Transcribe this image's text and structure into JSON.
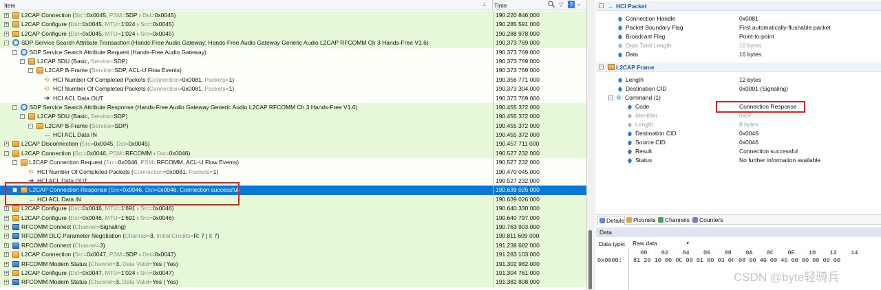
{
  "header": {
    "item_col": "Item",
    "time_col": "Time",
    "filter_badge": "3"
  },
  "rows": [
    {
      "indent": 0,
      "exp": "+",
      "icon": "fold",
      "parts": [
        [
          "L2CAP Connection (",
          ""
        ],
        [
          "Src=",
          "d"
        ],
        [
          "0x0045, ",
          ""
        ],
        [
          "PSM=",
          "d"
        ],
        [
          "SDP › ",
          ""
        ],
        [
          "Dst=",
          "d"
        ],
        [
          "0x0045)",
          ""
        ]
      ],
      "time": "190.220 846 000",
      "bg": "green"
    },
    {
      "indent": 0,
      "exp": "+",
      "icon": "fold",
      "parts": [
        [
          "L2CAP Configure (",
          ""
        ],
        [
          "Dst=",
          "d"
        ],
        [
          "0x0045, ",
          ""
        ],
        [
          "MTU=",
          "d"
        ],
        [
          "1'024 › ",
          ""
        ],
        [
          "Src=",
          "d"
        ],
        [
          "0x0045)",
          ""
        ]
      ],
      "time": "190.285 591 000",
      "bg": "green"
    },
    {
      "indent": 0,
      "exp": "+",
      "icon": "fold",
      "parts": [
        [
          "L2CAP Configure (",
          ""
        ],
        [
          "Dst=",
          "d"
        ],
        [
          "0x0045, ",
          ""
        ],
        [
          "MTU=",
          "d"
        ],
        [
          "1'024 › ",
          ""
        ],
        [
          "Src=",
          "d"
        ],
        [
          "0x0045)",
          ""
        ]
      ],
      "time": "190.288 978 000",
      "bg": "green"
    },
    {
      "indent": 0,
      "exp": "-",
      "icon": "sdp",
      "parts": [
        [
          "SDP Service Search Attribute Transaction (Hands-Free Audio Gateway: Hands-Free Audio Gateway Generic Audio L2CAP RFCOMM Ch 3 Hands-Free V1.6)",
          ""
        ]
      ],
      "time": "190.373 769 000",
      "bg": "green"
    },
    {
      "indent": 1,
      "exp": "-",
      "icon": "sdp",
      "parts": [
        [
          "SDP Service Search Attribute Request (Hands-Free Audio Gateway)",
          ""
        ]
      ],
      "time": "190.373 769 000",
      "bg": "white"
    },
    {
      "indent": 2,
      "exp": "-",
      "icon": "fold",
      "parts": [
        [
          "L2CAP SDU (Basic, ",
          ""
        ],
        [
          "Service=",
          "d"
        ],
        [
          "SDP)",
          ""
        ]
      ],
      "time": "190.373 769 000",
      "bg": "white"
    },
    {
      "indent": 3,
      "exp": "-",
      "icon": "fold",
      "parts": [
        [
          "L2CAP B-Frame (",
          ""
        ],
        [
          "Service=",
          "d"
        ],
        [
          "SDP, ACL-U Flow Events)",
          ""
        ]
      ],
      "time": "190.373 769 000",
      "bg": "white"
    },
    {
      "indent": 4,
      "exp": "",
      "icon": "hci",
      "parts": [
        [
          "HCI Number Of Completed Packets (",
          ""
        ],
        [
          "Connection=",
          "d"
        ],
        [
          "0x0081, ",
          ""
        ],
        [
          "Packets=",
          "d"
        ],
        [
          "1)",
          ""
        ]
      ],
      "time": "190.356 771 000",
      "bg": "white"
    },
    {
      "indent": 4,
      "exp": "",
      "icon": "hci",
      "parts": [
        [
          "HCI Number Of Completed Packets (",
          ""
        ],
        [
          "Connection=",
          "d"
        ],
        [
          "0x0081, ",
          ""
        ],
        [
          "Packets=",
          "d"
        ],
        [
          "1)",
          ""
        ]
      ],
      "time": "190.373 304 000",
      "bg": "white"
    },
    {
      "indent": 4,
      "exp": "",
      "icon": "out",
      "parts": [
        [
          "HCI ACL Data OUT",
          ""
        ]
      ],
      "time": "190.373 769 000",
      "bg": "white"
    },
    {
      "indent": 1,
      "exp": "-",
      "icon": "sdp",
      "parts": [
        [
          "SDP Service Search Attribute Response (Hands-Free Audio Gateway Generic Audio L2CAP RFCOMM Ch 3 Hands-Free V1.6)",
          ""
        ]
      ],
      "time": "190.455 372 000",
      "bg": "green"
    },
    {
      "indent": 2,
      "exp": "-",
      "icon": "fold",
      "parts": [
        [
          "L2CAP SDU (Basic, ",
          ""
        ],
        [
          "Service=",
          "d"
        ],
        [
          "SDP)",
          ""
        ]
      ],
      "time": "190.455 372 000",
      "bg": "green"
    },
    {
      "indent": 3,
      "exp": "-",
      "icon": "fold",
      "parts": [
        [
          "L2CAP B-Frame (",
          ""
        ],
        [
          "Service=",
          "d"
        ],
        [
          "SDP)",
          ""
        ]
      ],
      "time": "190.455 372 000",
      "bg": "green"
    },
    {
      "indent": 4,
      "exp": "",
      "icon": "in",
      "parts": [
        [
          "HCI ACL Data IN",
          ""
        ]
      ],
      "time": "190.455 372 000",
      "bg": "green"
    },
    {
      "indent": 0,
      "exp": "+",
      "icon": "fold",
      "parts": [
        [
          "L2CAP Disconnection (",
          ""
        ],
        [
          "Src=",
          "d"
        ],
        [
          "0x0045, ",
          ""
        ],
        [
          "Dst=",
          "d"
        ],
        [
          "0x0045)",
          ""
        ]
      ],
      "time": "190.457 711 000",
      "bg": "green"
    },
    {
      "indent": 0,
      "exp": "-",
      "icon": "fold",
      "parts": [
        [
          "L2CAP Connection (",
          ""
        ],
        [
          "Src=",
          "d"
        ],
        [
          "0x0046, ",
          ""
        ],
        [
          "PSM=",
          "d"
        ],
        [
          "RFCOMM › ",
          ""
        ],
        [
          "Dst=",
          "d"
        ],
        [
          "0x0046)",
          ""
        ]
      ],
      "time": "190.527 232 000",
      "bg": "green"
    },
    {
      "indent": 1,
      "exp": "-",
      "icon": "fold",
      "parts": [
        [
          "L2CAP Connection Request (",
          ""
        ],
        [
          "Src=",
          "d"
        ],
        [
          "0x0046, ",
          ""
        ],
        [
          "PSM=",
          "d"
        ],
        [
          "RFCOMM, ACL-U Flow Events)",
          ""
        ]
      ],
      "time": "190.527 232 000",
      "bg": "white"
    },
    {
      "indent": 2,
      "exp": "",
      "icon": "hci",
      "parts": [
        [
          "HCI Number Of Completed Packets (",
          ""
        ],
        [
          "Connection=",
          "d"
        ],
        [
          "0x0081, ",
          ""
        ],
        [
          "Packets=",
          "d"
        ],
        [
          "1)",
          ""
        ]
      ],
      "time": "190.470 045 000",
      "bg": "white"
    },
    {
      "indent": 2,
      "exp": "",
      "icon": "out",
      "parts": [
        [
          "HCI ACL Data OUT",
          ""
        ]
      ],
      "time": "190.527 232 000",
      "bg": "white"
    },
    {
      "indent": 1,
      "exp": "-",
      "icon": "fold",
      "parts": [
        [
          "L2CAP Connection Response (",
          ""
        ],
        [
          "Src=",
          "d"
        ],
        [
          "0x0046, ",
          ""
        ],
        [
          "Dst=",
          "d"
        ],
        [
          "0x0046, Connection successful)",
          ""
        ]
      ],
      "time": "190.639 026 000",
      "bg": "selected"
    },
    {
      "indent": 2,
      "exp": "",
      "icon": "in",
      "parts": [
        [
          "HCI ACL Data IN",
          ""
        ]
      ],
      "time": "190.639 026 000",
      "bg": "green"
    },
    {
      "indent": 0,
      "exp": "+",
      "icon": "fold",
      "parts": [
        [
          "L2CAP Configure (",
          ""
        ],
        [
          "Dst=",
          "d"
        ],
        [
          "0x0046, ",
          ""
        ],
        [
          "MTU=",
          "d"
        ],
        [
          "1'691 › ",
          ""
        ],
        [
          "Src=",
          "d"
        ],
        [
          "0x0046)",
          ""
        ]
      ],
      "time": "190.640 330 000",
      "bg": "green"
    },
    {
      "indent": 0,
      "exp": "+",
      "icon": "fold",
      "parts": [
        [
          "L2CAP Configure (",
          ""
        ],
        [
          "Dst=",
          "d"
        ],
        [
          "0x0046, ",
          ""
        ],
        [
          "MTU=",
          "d"
        ],
        [
          "1'691 › ",
          ""
        ],
        [
          "Src=",
          "d"
        ],
        [
          "0x0046)",
          ""
        ]
      ],
      "time": "190.640 797 000",
      "bg": "green"
    },
    {
      "indent": 0,
      "exp": "+",
      "icon": "rf",
      "parts": [
        [
          "RFCOMM Connect (",
          ""
        ],
        [
          "Channel=",
          "d"
        ],
        [
          "Signaling)",
          ""
        ]
      ],
      "time": "190.763 903 000",
      "bg": "green"
    },
    {
      "indent": 0,
      "exp": "+",
      "icon": "rf",
      "parts": [
        [
          "RFCOMM DLC Parameter Negotiation (",
          ""
        ],
        [
          "Channel=",
          "d"
        ],
        [
          "3, ",
          ""
        ],
        [
          "Initial Credits=",
          "d"
        ],
        [
          "R: 7 | I: 7)",
          ""
        ]
      ],
      "time": "190.811 609 000",
      "bg": "green"
    },
    {
      "indent": 0,
      "exp": "+",
      "icon": "rf",
      "parts": [
        [
          "RFCOMM Connect (",
          ""
        ],
        [
          "Channel=",
          "d"
        ],
        [
          "3)",
          ""
        ]
      ],
      "time": "191.238 682 000",
      "bg": "green"
    },
    {
      "indent": 0,
      "exp": "+",
      "icon": "fold",
      "parts": [
        [
          "L2CAP Connection (",
          ""
        ],
        [
          "Src=",
          "d"
        ],
        [
          "0x0047, ",
          ""
        ],
        [
          "PSM=",
          "d"
        ],
        [
          "SDP › ",
          ""
        ],
        [
          "Dst=",
          "d"
        ],
        [
          "0x0047)",
          ""
        ]
      ],
      "time": "191.283 103 000",
      "bg": "green"
    },
    {
      "indent": 0,
      "exp": "+",
      "icon": "rf",
      "parts": [
        [
          "RFCOMM Modem Status (",
          ""
        ],
        [
          "Channel=",
          "d"
        ],
        [
          "3, ",
          ""
        ],
        [
          "Data Valid=",
          "d"
        ],
        [
          "Yes | Yes)",
          ""
        ]
      ],
      "time": "191.302 982 000",
      "bg": "green"
    },
    {
      "indent": 0,
      "exp": "+",
      "icon": "fold",
      "parts": [
        [
          "L2CAP Configure (",
          ""
        ],
        [
          "Dst=",
          "d"
        ],
        [
          "0x0047, ",
          ""
        ],
        [
          "MTU=",
          "d"
        ],
        [
          "1'024 › ",
          ""
        ],
        [
          "Src=",
          "d"
        ],
        [
          "0x0047)",
          ""
        ]
      ],
      "time": "191.304 761 000",
      "bg": "green"
    },
    {
      "indent": 0,
      "exp": "+",
      "icon": "rf",
      "parts": [
        [
          "RFCOMM Modem Status (",
          ""
        ],
        [
          "Channel=",
          "d"
        ],
        [
          "3, ",
          ""
        ],
        [
          "Data Valid=",
          "d"
        ],
        [
          "Yes | Yes)",
          ""
        ]
      ],
      "time": "191.382 808 000",
      "bg": "green"
    }
  ],
  "details": {
    "hci_title": "HCI Packet",
    "hci_fields": [
      {
        "name": "Connection Handle",
        "value": "0x0081"
      },
      {
        "name": "Packet Boundary Flag",
        "value": "First automatically-flushable packet"
      },
      {
        "name": "Broadcast Flag",
        "value": "Point-to-point"
      },
      {
        "name": "Data Total Length",
        "value": "16 bytes",
        "dim": true
      },
      {
        "name": "Data",
        "value": "16 bytes"
      }
    ],
    "l2cap_title": "L2CAP Frame",
    "l2cap_fields": [
      {
        "name": "Length",
        "value": "12 bytes"
      },
      {
        "name": "Destination CID",
        "value": "0x0001 (Signaling)"
      }
    ],
    "command_label": "Command (1)",
    "command_fields": [
      {
        "name": "Code",
        "value": "Connection Response"
      },
      {
        "name": "Identifier",
        "value": "0x0F",
        "dim": true
      },
      {
        "name": "Length",
        "value": "8 bytes",
        "dim": true
      },
      {
        "name": "Destination CID",
        "value": "0x0046"
      },
      {
        "name": "Source CID",
        "value": "0x0046"
      },
      {
        "name": "Result",
        "value": "Connection successful"
      },
      {
        "name": "Status",
        "value": "No further information available"
      }
    ]
  },
  "tabs": [
    "Details",
    "Piconets",
    "Channels",
    "Counters"
  ],
  "data_panel": {
    "title": "Data",
    "type_label": "Data type:",
    "type_value": "Raw data",
    "hex_columns": "  00    02    04    06    08    0A    0C    0E    10    12    14",
    "hex_offset": "0x0000:",
    "hex_bytes": "81 20 10 00 0C 00 01 00 03 0F 08 00 46 00 46 00 00 00 00 00"
  },
  "watermark": "CSDN @byte轻骑兵",
  "colors": {
    "selection": "#0a79d5",
    "row_green": "#e7f8d9",
    "accent": "#1e56a0",
    "highlight_box": "#e02020"
  }
}
